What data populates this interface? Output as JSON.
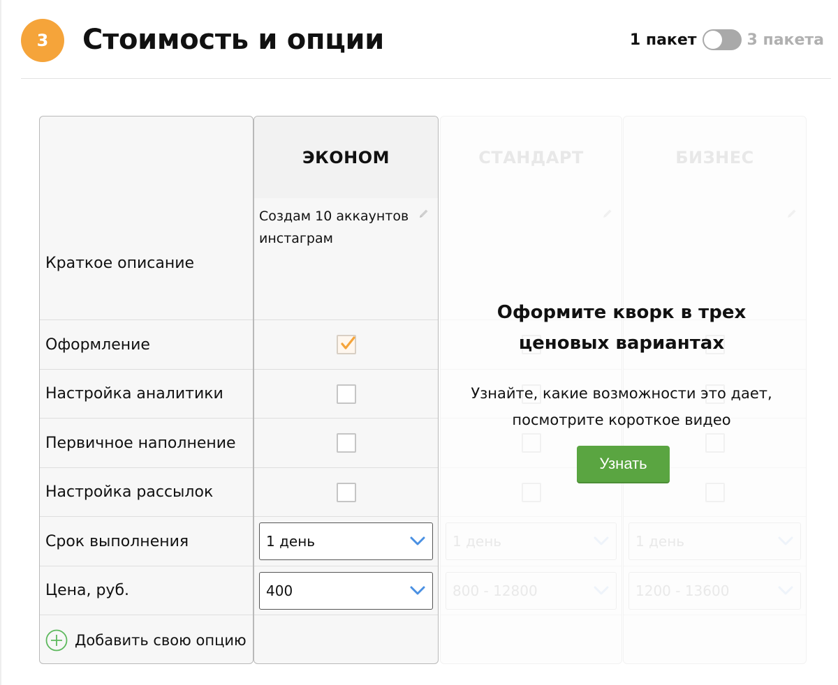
{
  "header": {
    "step_number": "3",
    "title": "Стоимость и опции",
    "toggle_left_label": "1 пакет",
    "toggle_right_label": "3 пакета",
    "toggle_on": false
  },
  "rows": {
    "description": "Краткое описание",
    "design": "Оформление",
    "analytics": "Настройка аналитики",
    "filling": "Первичное наполнение",
    "mailing": "Настройка рассылок",
    "deadline": "Срок выполнения",
    "price": "Цена, руб.",
    "add_option": "Добавить свою опцию"
  },
  "packages": {
    "econom": {
      "name": "ЭКОНОМ",
      "description": "Создам 10 аккаунтов инстаграм",
      "design_checked": true,
      "analytics_checked": false,
      "filling_checked": false,
      "mailing_checked": false,
      "deadline": "1 день",
      "price": "400"
    },
    "standart": {
      "name": "СТАНДАРТ",
      "deadline": "1 день",
      "price": "800 - 12800"
    },
    "biznes": {
      "name": "БИЗНЕС",
      "deadline": "1 день",
      "price": "1200 - 13600"
    }
  },
  "promo": {
    "title": "Оформите кворк в трех ценовых вариантах",
    "text": "Узнайте, какие возможности это дает, посмотрите короткое видео",
    "button": "Узнать"
  },
  "colors": {
    "accent_orange": "#f5a43a",
    "button_green": "#5aa541",
    "chevron_blue": "#4a90e2"
  }
}
